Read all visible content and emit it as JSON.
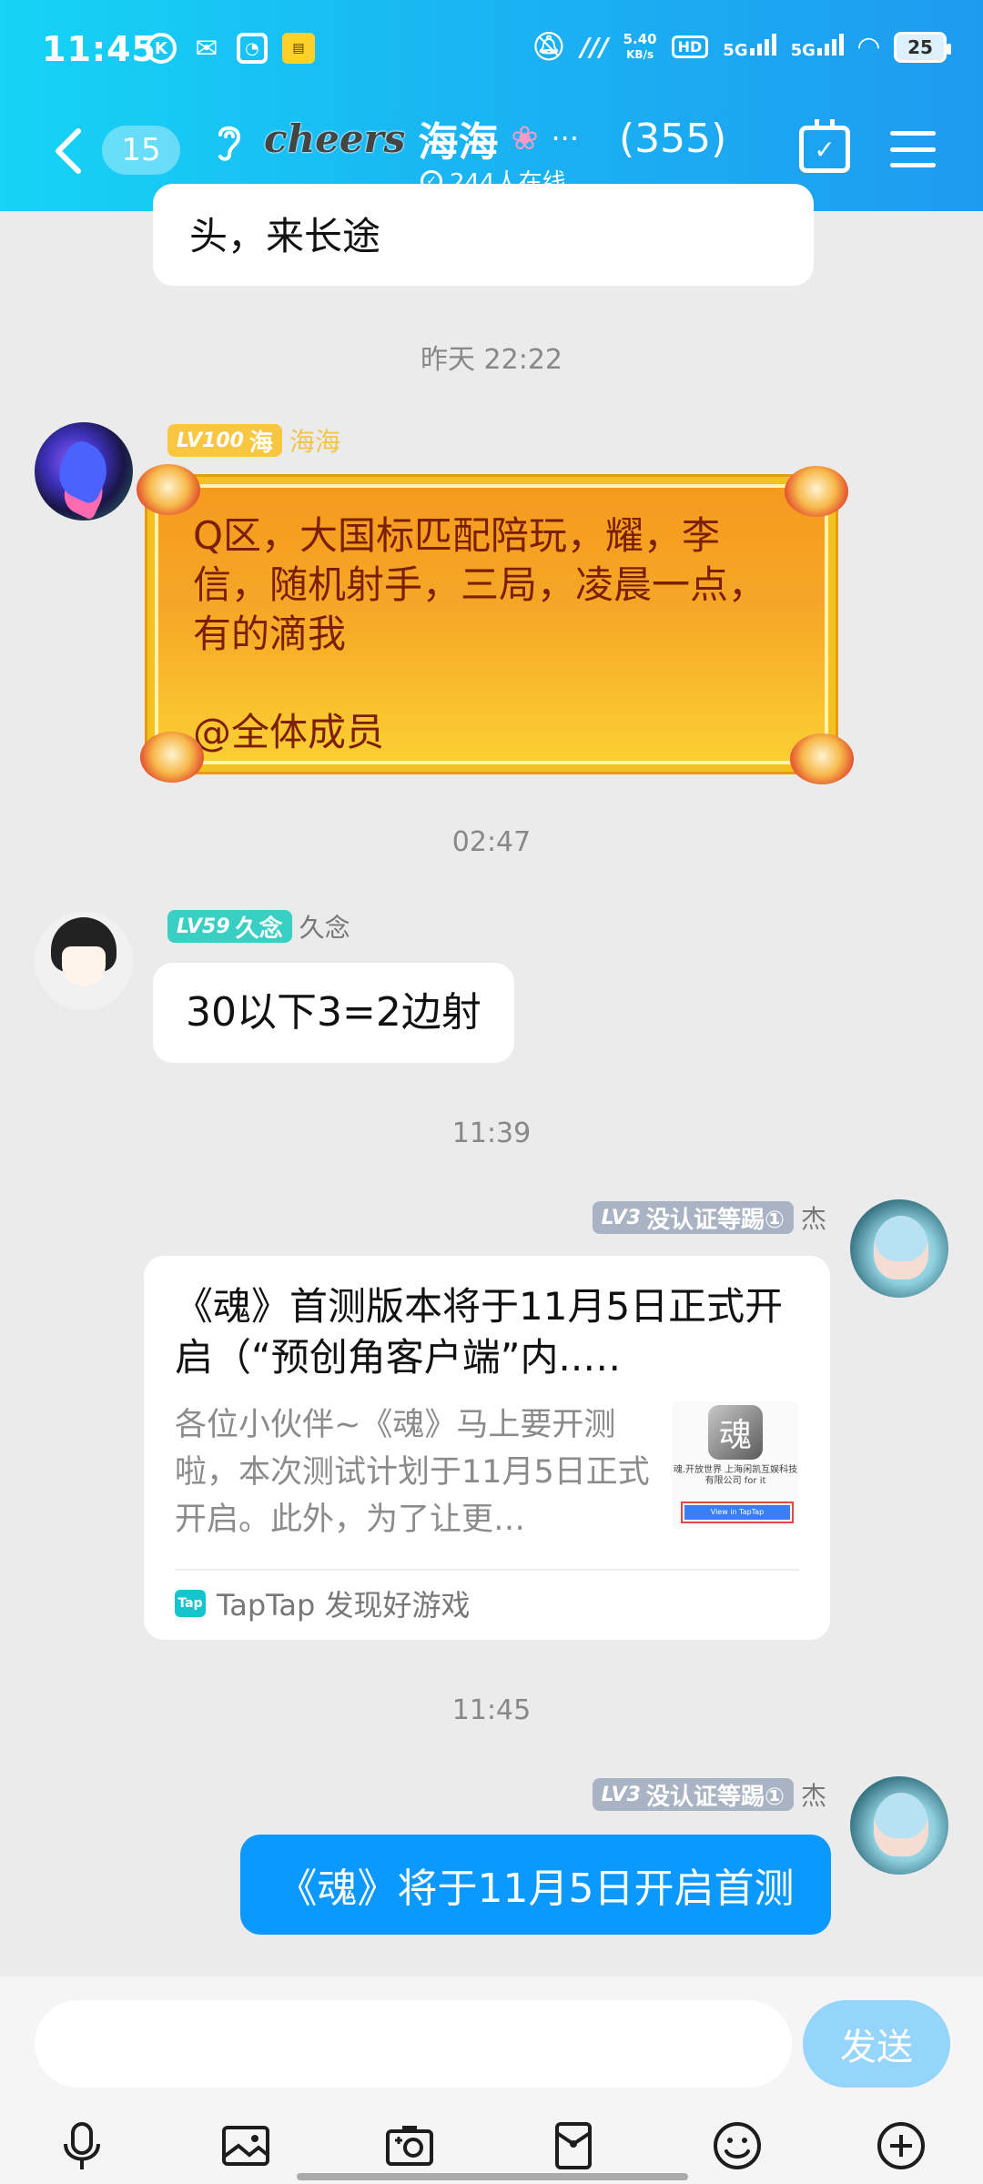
{
  "status_bar": {
    "time": "11:45",
    "net_speed_value": "5.40",
    "net_speed_unit": "KB/s",
    "hd": "HD",
    "sim1": "5G",
    "sim2": "5G",
    "battery": "25"
  },
  "header": {
    "unread_count": "15",
    "group_name_prefix": "cheers",
    "group_name": "海海",
    "ellipsis": "···",
    "member_count": "(355)",
    "online_text": "244人在线"
  },
  "messages": {
    "prev_text": "头，来长途",
    "ts1": "昨天 22:22",
    "msg1": {
      "level": "LV100",
      "title": "海",
      "nickname": "海海",
      "line1": "Q区，大国标匹配陪玩，耀，李信，随机射手，三局，凌晨一点，有的滴我",
      "line2": "@全体成员"
    },
    "ts2": "02:47",
    "msg2": {
      "level": "LV59",
      "title": "久念",
      "nickname": "久念",
      "text": "30以下3=2边射"
    },
    "ts3": "11:39",
    "msg3": {
      "level": "LV3",
      "title": "没认证等踢①",
      "nickname": "杰",
      "card_title": "《魂》首测版本将于11月5日正式开启（“预创角客户端”内..…",
      "card_desc": "各位小伙伴~《魂》马上要开测啦，本次测试计划于11月5日正式开启。此外，为了让更…",
      "thumb_char": "魂",
      "thumb_text": "魂.开放世界\n上海闲凯互娱科技有限公司 for it",
      "thumb_btn": "View in TapTap",
      "card_source_logo": "Tap",
      "card_source": "TapTap 发现好游戏"
    },
    "ts4": "11:45",
    "msg4": {
      "level": "LV3",
      "title": "没认证等踢①",
      "nickname": "杰",
      "text": "《魂》将于11月5日开启首测"
    }
  },
  "input": {
    "placeholder": "",
    "send_label": "发送"
  },
  "toolbar": [
    "voice-icon",
    "image-icon",
    "camera-icon",
    "red-packet-icon",
    "emoji-icon",
    "plus-icon"
  ],
  "colors": {
    "header_gradient_start": "#16d4f5",
    "header_gradient_end": "#1e9bf0",
    "my_bubble": "#0b99ff",
    "send_button": "#95d5fb",
    "gold_badge": "#f8c640",
    "teal_badge": "#39cfc3",
    "gray_badge": "#a9b3c3"
  }
}
